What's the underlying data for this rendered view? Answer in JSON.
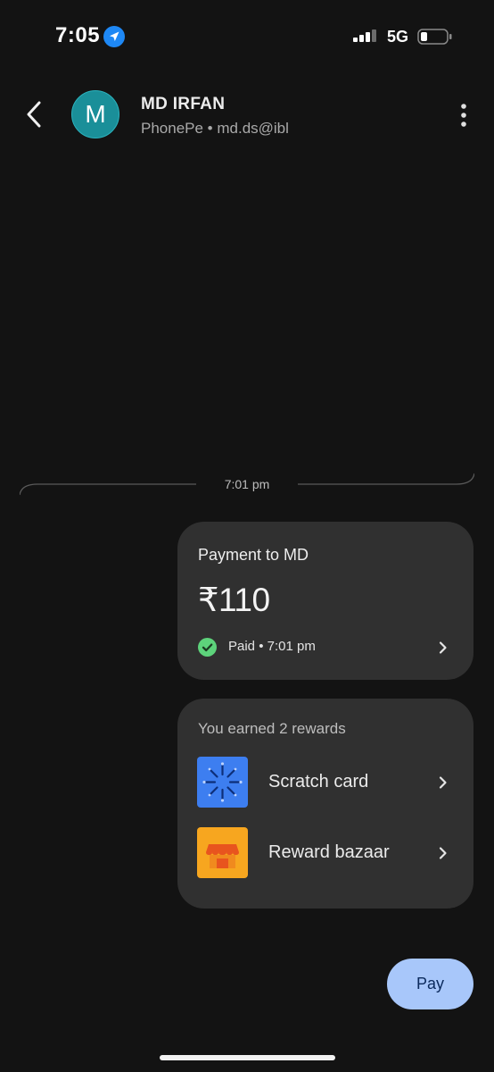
{
  "status_bar": {
    "time": "7:05",
    "network": "5G",
    "icons": [
      "location-arrow-icon",
      "signal-icon",
      "battery-icon"
    ]
  },
  "header": {
    "avatar_letter": "M",
    "avatar_color": "#1a8f99",
    "contact_name": "MD IRFAN",
    "contact_subtitle": "PhonePe • md.ds@ibl",
    "icons": [
      "back-icon",
      "more-vert-icon"
    ]
  },
  "conversation": {
    "divider_time": "7:01 pm",
    "payment": {
      "title": "Payment to MD",
      "amount": "₹110",
      "status": "Paid • 7:01 pm",
      "status_color": "#5dd37b"
    },
    "rewards": {
      "heading": "You earned 2 rewards",
      "items": [
        {
          "label": "Scratch card",
          "icon": "scratch-card-icon",
          "color": "#3d7ef0"
        },
        {
          "label": "Reward bazaar",
          "icon": "storefront-icon",
          "color": "#f7a61f"
        }
      ]
    }
  },
  "actions": {
    "pay_label": "Pay",
    "pay_color": "#a8c7fa"
  }
}
